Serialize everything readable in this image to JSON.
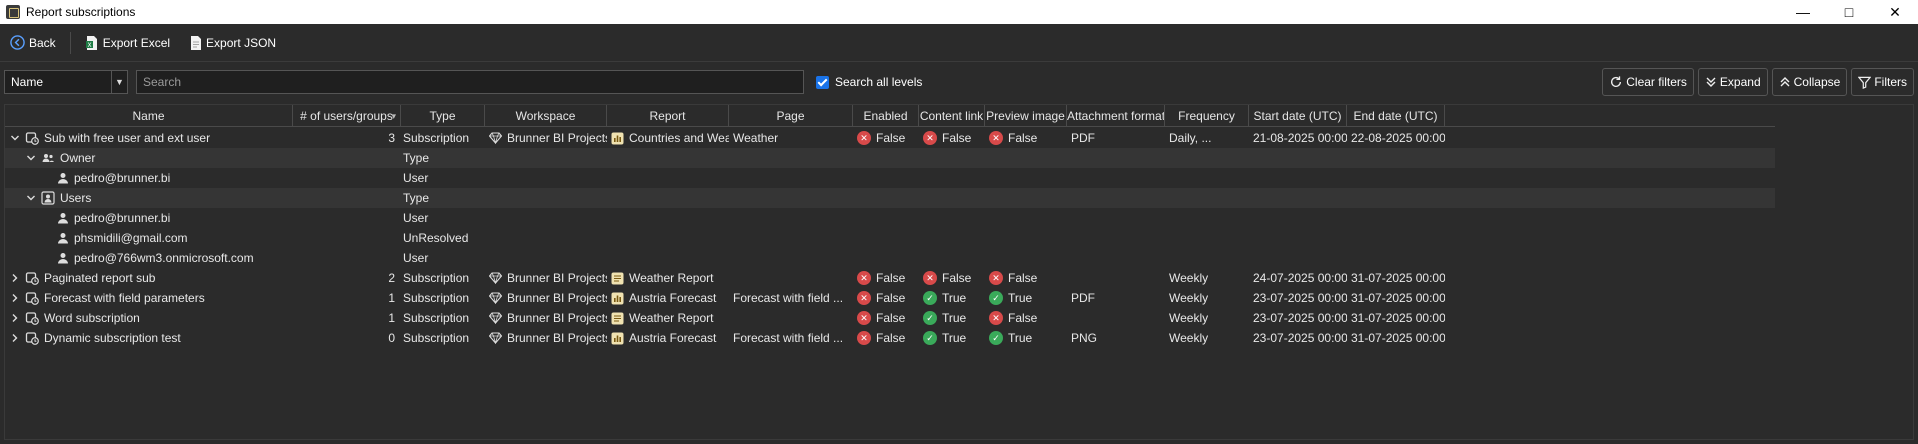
{
  "window": {
    "title": "Report subscriptions",
    "minimize": "—",
    "maximize": "□",
    "close": "✕"
  },
  "toolbar": {
    "back": "Back",
    "export_excel": "Export Excel",
    "export_json": "Export JSON"
  },
  "filter": {
    "field_selected": "Name",
    "search_placeholder": "Search",
    "search_all_levels": "Search all levels",
    "search_all_checked": true,
    "clear_filters": "Clear filters",
    "expand": "Expand",
    "collapse": "Collapse",
    "filters": "Filters"
  },
  "columns": [
    "Name",
    "# of users/groups",
    "Type",
    "Workspace",
    "Report",
    "Page",
    "Enabled",
    "Content link",
    "Preview image",
    "Attachment format",
    "Frequency",
    "Start date (UTC)",
    "End date (UTC)"
  ],
  "rows": [
    {
      "level": 0,
      "expander": "open",
      "icon": "subscription-icon",
      "name": "Sub with free user and ext user",
      "count": "3",
      "type": "Subscription",
      "workspace": "Brunner BI Projects",
      "report_icon": "report-chart-icon",
      "report": "Countries and Weather",
      "page": "Weather",
      "enabled": "False",
      "content_link": "False",
      "preview_image": "False",
      "attachment": "PDF",
      "frequency": "Daily, ...",
      "start": "21-08-2025 00:00:00",
      "end": "22-08-2025 00:00:00"
    },
    {
      "level": 1,
      "expander": "open",
      "icon": "owner-group-icon",
      "name": "Owner",
      "type": "Type",
      "alt": true
    },
    {
      "level": 2,
      "icon": "user-icon",
      "name": "pedro@brunner.bi",
      "type": "User"
    },
    {
      "level": 1,
      "expander": "open",
      "icon": "users-group-icon",
      "name": "Users",
      "type": "Type",
      "alt": true
    },
    {
      "level": 2,
      "icon": "user-icon",
      "name": "pedro@brunner.bi",
      "type": "User"
    },
    {
      "level": 2,
      "icon": "user-icon",
      "name": "phsmidili@gmail.com",
      "type": "UnResolved"
    },
    {
      "level": 2,
      "icon": "user-icon",
      "name": "pedro@766wm3.onmicrosoft.com",
      "type": "User"
    },
    {
      "level": 0,
      "expander": "closed",
      "icon": "subscription-icon",
      "name": "Paginated report sub",
      "count": "2",
      "type": "Subscription",
      "workspace": "Brunner BI Projects",
      "report_icon": "report-paginated-icon",
      "report": "Weather Report",
      "page": "",
      "enabled": "False",
      "content_link": "False",
      "preview_image": "False",
      "attachment": "",
      "frequency": "Weekly",
      "start": "24-07-2025 00:00:00",
      "end": "31-07-2025 00:00:00"
    },
    {
      "level": 0,
      "expander": "closed",
      "icon": "subscription-icon",
      "name": "Forecast with field parameters",
      "count": "1",
      "type": "Subscription",
      "workspace": "Brunner BI Projects",
      "report_icon": "report-chart-icon",
      "report": "Austria Forecast",
      "page": "Forecast with field ...",
      "enabled": "False",
      "content_link": "True",
      "preview_image": "True",
      "attachment": "PDF",
      "frequency": "Weekly",
      "start": "23-07-2025 00:00:00",
      "end": "31-07-2025 00:00:00"
    },
    {
      "level": 0,
      "expander": "closed",
      "icon": "subscription-icon",
      "name": "Word subscription",
      "count": "1",
      "type": "Subscription",
      "workspace": "Brunner BI Projects",
      "report_icon": "report-paginated-icon",
      "report": "Weather Report",
      "page": "",
      "enabled": "False",
      "content_link": "True",
      "preview_image": "False",
      "attachment": "",
      "frequency": "Weekly",
      "start": "23-07-2025 00:00:00",
      "end": "31-07-2025 00:00:00"
    },
    {
      "level": 0,
      "expander": "closed",
      "icon": "subscription-icon",
      "name": "Dynamic subscription test",
      "count": "0",
      "type": "Subscription",
      "workspace": "Brunner BI Projects",
      "report_icon": "report-chart-icon",
      "report": "Austria Forecast",
      "page": "Forecast with field ...",
      "enabled": "False",
      "content_link": "True",
      "preview_image": "True",
      "attachment": "PNG",
      "frequency": "Weekly",
      "start": "23-07-2025 00:00:00",
      "end": "31-07-2025 00:00:00"
    }
  ],
  "colors": {
    "background": "#2b2b2b",
    "alt_row": "#353535",
    "status_false": "#d84a4a",
    "status_true": "#3aaa5a",
    "checkbox": "#1a73e8"
  }
}
